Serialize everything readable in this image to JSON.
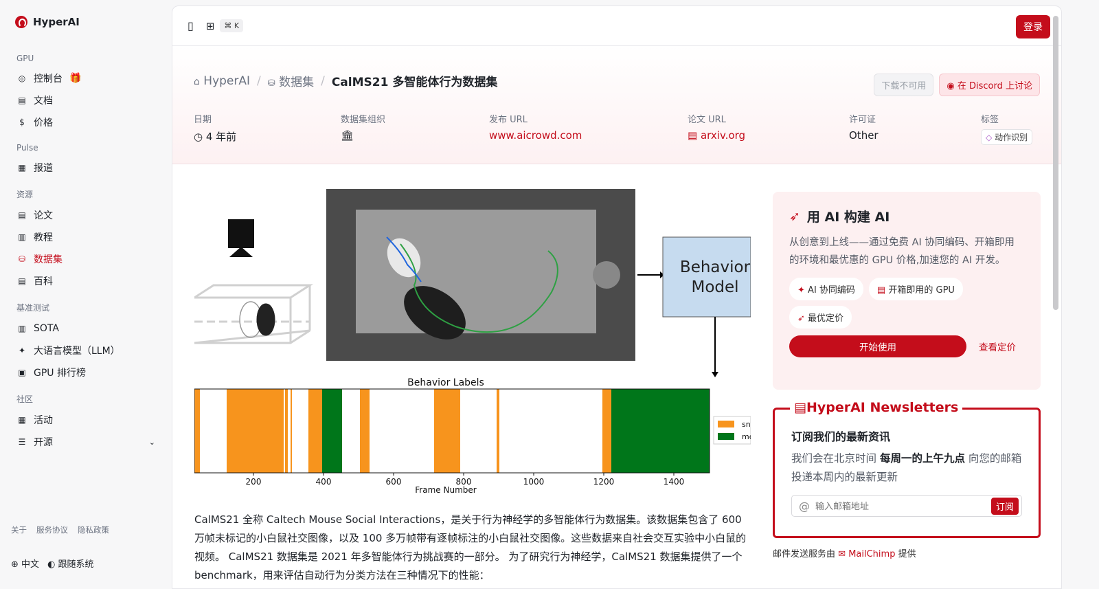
{
  "brand": {
    "name": "HyperAI"
  },
  "sidebar": {
    "sections": [
      {
        "title": "GPU",
        "items": [
          {
            "label": "控制台",
            "icon": "gauge-icon"
          },
          {
            "label": "文档",
            "icon": "book-icon"
          },
          {
            "label": "价格",
            "icon": "dollar-icon"
          }
        ]
      },
      {
        "title": "Pulse",
        "items": [
          {
            "label": "报道",
            "icon": "news-icon"
          }
        ]
      },
      {
        "title": "资源",
        "items": [
          {
            "label": "论文",
            "icon": "paper-icon"
          },
          {
            "label": "教程",
            "icon": "tutorial-icon"
          },
          {
            "label": "数据集",
            "icon": "database-icon"
          },
          {
            "label": "百科",
            "icon": "encyclopedia-icon"
          }
        ]
      },
      {
        "title": "基准测试",
        "items": [
          {
            "label": "SOTA",
            "icon": "bar-chart-icon"
          },
          {
            "label": "大语言模型（LLM）",
            "icon": "sparkle-icon"
          },
          {
            "label": "GPU 排行榜",
            "icon": "chip-icon"
          }
        ]
      },
      {
        "title": "社区",
        "items": [
          {
            "label": "活动",
            "icon": "calendar-icon"
          },
          {
            "label": "开源",
            "icon": "list-icon"
          }
        ]
      }
    ],
    "footer_links": [
      "关于",
      "服务协议",
      "隐私政策"
    ],
    "lang": "中文",
    "theme": "跟随系统"
  },
  "topbar": {
    "shortcut": "⌘ K",
    "login": "登录"
  },
  "breadcrumb": {
    "home": "HyperAI",
    "datasets": "数据集",
    "current": "CalMS21 多智能体行为数据集"
  },
  "hero_buttons": {
    "download": "下载不可用",
    "discord": "在 Discord 上讨论"
  },
  "meta": {
    "date_label": "日期",
    "date_value": "4 年前",
    "org_label": "数据集组织",
    "url_label": "发布 URL",
    "url_value": "www.aicrowd.com",
    "paper_label": "论文 URL",
    "paper_value": "arxiv.org",
    "license_label": "许可证",
    "license_value": "Other",
    "tags_label": "标签",
    "tag_value": "动作识别"
  },
  "figure": {
    "model_box": [
      "Behavior",
      "Model"
    ],
    "labels_title": "Behavior Labels",
    "x_axis_label": "Frame Number",
    "ticks": [
      "200",
      "400",
      "600",
      "800",
      "1000",
      "1200",
      "1400"
    ],
    "legend": [
      "sn",
      "mo"
    ],
    "colors": {
      "orange": "#f7941d",
      "green": "#00761a"
    }
  },
  "description": "CalMS21 全称 Caltech Mouse Social Interactions，是关于行为神经学的多智能体行为数据集。该数据集包含了 600 万帧未标记的小白鼠社交图像，以及 100 多万帧带有逐帧标注的小白鼠社交图像。这些数据来自社会交互实验中小白鼠的视频。 CalMS21 数据集是 2021 年多智能体行为挑战赛的一部分。 为了研究行为神经学，CalMS21 数据集提供了一个 benchmark，用来评估自动行为分类方法在三种情况下的性能：",
  "promo": {
    "title": "用 AI 构建 AI",
    "text": "从创意到上线——通过免费 AI 协同编码、开箱即用的环境和最优惠的 GPU 价格,加速您的 AI 开发。",
    "chips": [
      "AI 协同编码",
      "开箱即用的 GPU",
      "最优定价"
    ],
    "start": "开始使用",
    "pricing": "查看定价"
  },
  "newsletter": {
    "title": "HyperAI Newsletters",
    "heading": "订阅我们的最新资讯",
    "text_pre": "我们会在北京时间 ",
    "text_bold": "每周一的上午九点",
    "text_post": " 向您的邮箱投递本周内的最新更新",
    "placeholder": "输入邮箱地址",
    "subscribe": "订阅",
    "service_pre": "邮件发送服务由",
    "service_name": "MailChimp",
    "service_post": "提供"
  }
}
